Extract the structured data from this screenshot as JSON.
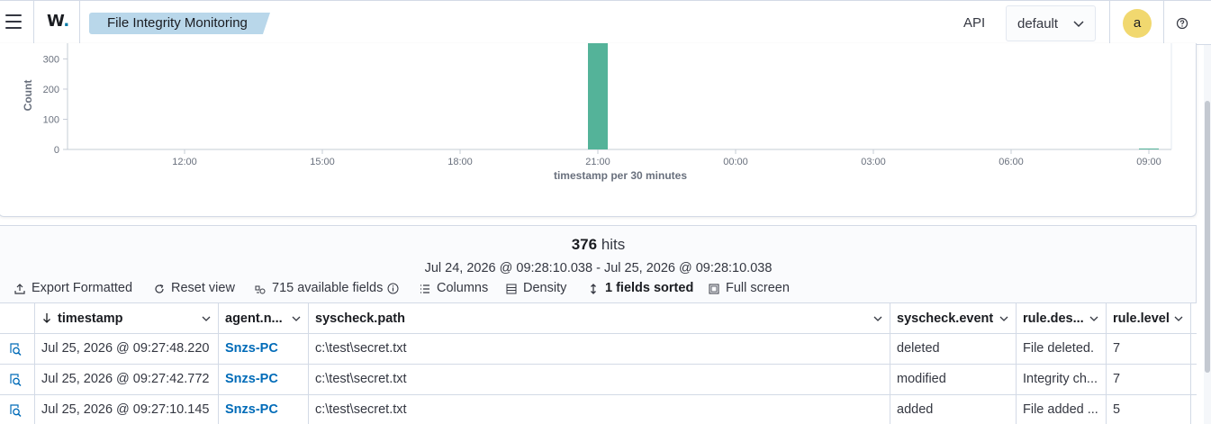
{
  "header": {
    "logo_text": "W",
    "logo_dot": ".",
    "breadcrumb": "File Integrity Monitoring",
    "api_label": "API",
    "api_select_value": "default",
    "user_initial": "a",
    "accent": "#b9d7ea",
    "avatar_color": "#f1d86f"
  },
  "chart_data": {
    "type": "bar",
    "ylabel": "Count",
    "xlabel": "timestamp per 30 minutes",
    "y_ticks": [
      "0",
      "100",
      "200",
      "300"
    ],
    "x_ticks": [
      "12:00",
      "15:00",
      "18:00",
      "21:00",
      "00:00",
      "03:00",
      "06:00",
      "09:00"
    ],
    "ylim": [
      0,
      376
    ],
    "bars": [
      {
        "x": "21:00",
        "value": 373
      },
      {
        "x": "09:00",
        "value": 3
      }
    ],
    "bar_color": "#54b399",
    "grid": false
  },
  "results": {
    "hits_count": "376",
    "hits_label": "hits",
    "time_range": "Jul 24, 2026 @ 09:28:10.038 - Jul 25, 2026 @ 09:28:10.038"
  },
  "toolbar": {
    "export": "Export Formatted",
    "reset": "Reset view",
    "fields": "715 available fields",
    "columns": "Columns",
    "density": "Density",
    "sorted": "1 fields sorted",
    "fullscreen": "Full screen"
  },
  "table": {
    "columns": [
      "timestamp",
      "agent.n...",
      "syscheck.path",
      "syscheck.event",
      "rule.des...",
      "rule.level"
    ],
    "rows": [
      [
        "Jul 25, 2026 @ 09:27:48.220",
        "Snzs-PC",
        "c:\\test\\secret.txt",
        "deleted",
        "File deleted.",
        "7"
      ],
      [
        "Jul 25, 2026 @ 09:27:42.772",
        "Snzs-PC",
        "c:\\test\\secret.txt",
        "modified",
        "Integrity ch...",
        "7"
      ],
      [
        "Jul 25, 2026 @ 09:27:10.145",
        "Snzs-PC",
        "c:\\test\\secret.txt",
        "added",
        "File added ...",
        "5"
      ]
    ]
  }
}
